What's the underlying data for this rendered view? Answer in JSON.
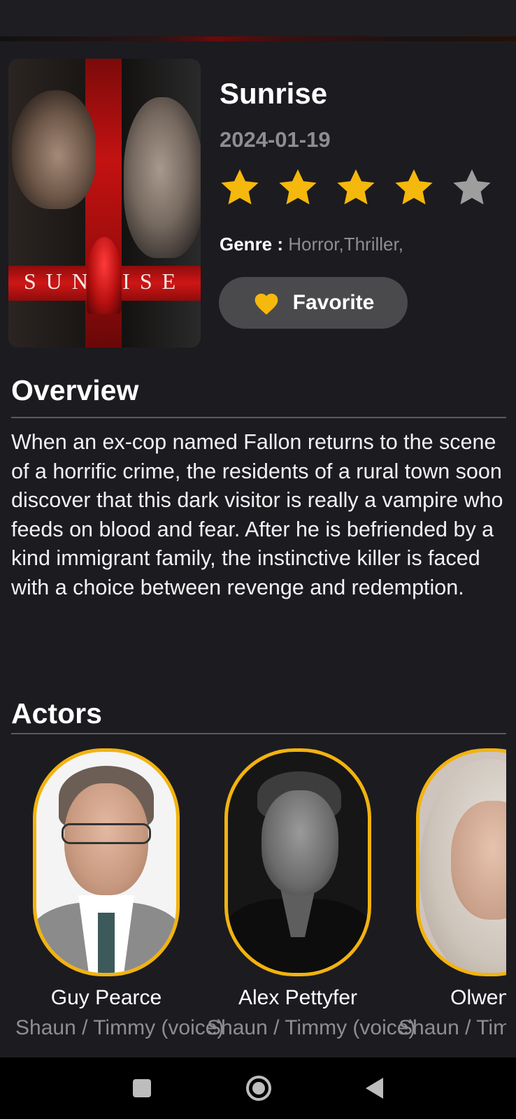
{
  "movie": {
    "poster_title": "SUNRISE",
    "title": "Sunrise",
    "release_date": "2024-01-19",
    "rating": {
      "value": 4,
      "max": 5
    },
    "genre_label": "Genre : ",
    "genre_value": "Horror,Thriller,",
    "favorite_label": "Favorite"
  },
  "overview": {
    "heading": "Overview",
    "text": "When an ex-cop named Fallon returns to the scene of a horrific crime, the residents of a rural town soon discover that this dark visitor is really a vampire who feeds on blood and fear. After he is befriended by a kind immigrant family, the instinctive killer is faced with a choice between revenge and redemption."
  },
  "actors": {
    "heading": "Actors",
    "items": [
      {
        "name": "Guy Pearce",
        "role": "Shaun / Timmy (voice)"
      },
      {
        "name": "Alex Pettyfer",
        "role": "Shaun / Timmy (voice)"
      },
      {
        "name": "Olwen F",
        "role": "Shaun / Timmy (voice)"
      }
    ]
  },
  "colors": {
    "background": "#1c1b20",
    "accent": "#f2b30f",
    "muted_text": "#8e8e92",
    "button": "#4a4a4c"
  },
  "icons": [
    "star-icon",
    "heart-icon",
    "recents-icon",
    "home-icon",
    "back-icon"
  ]
}
